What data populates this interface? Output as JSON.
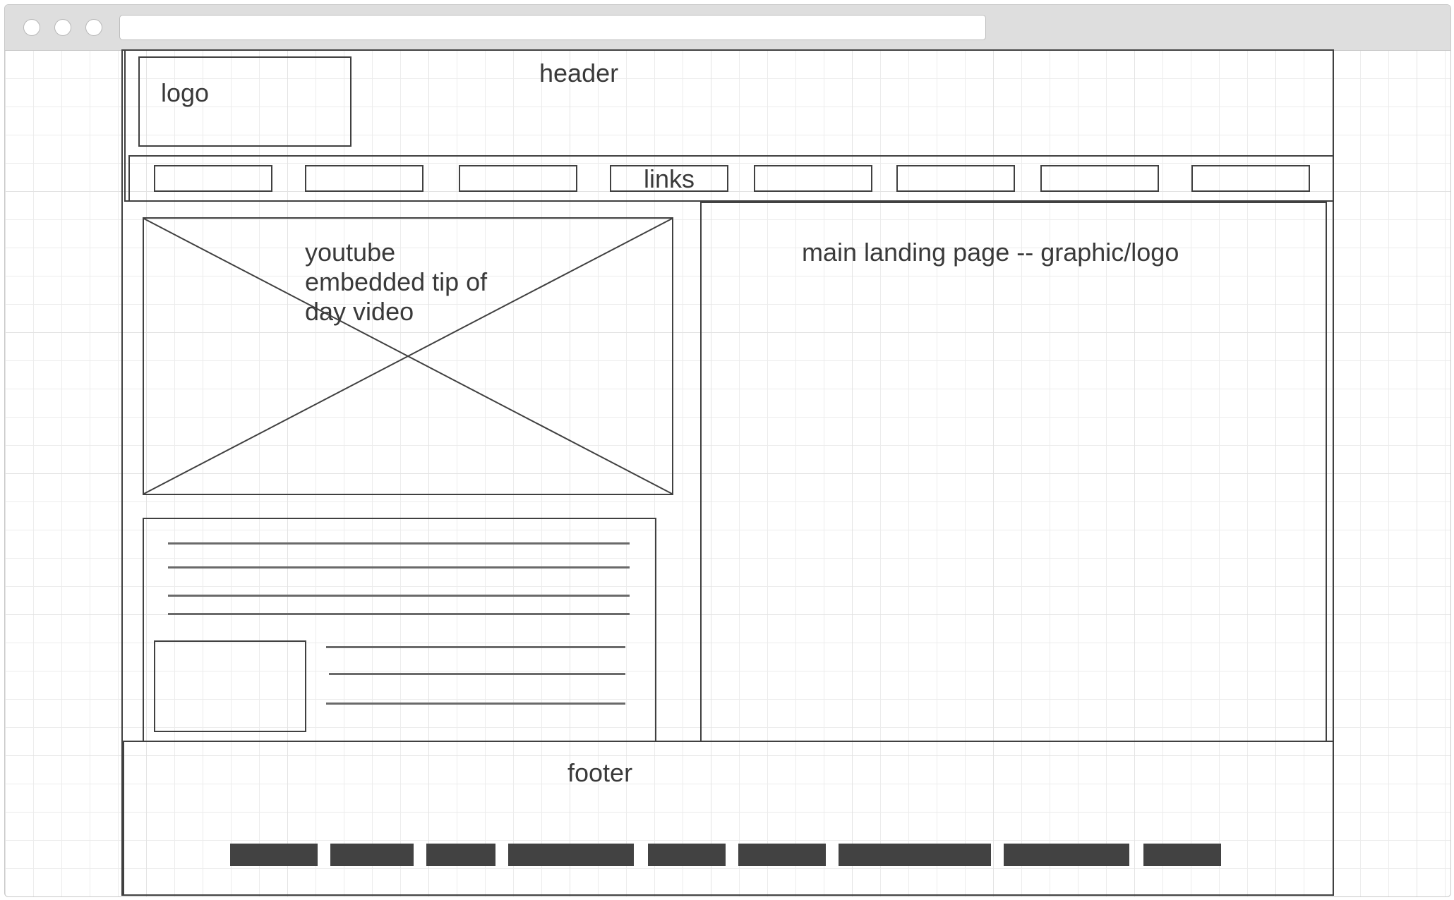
{
  "header": {
    "label": "header",
    "logo_label": "logo"
  },
  "nav": {
    "items": [
      {
        "label": ""
      },
      {
        "label": ""
      },
      {
        "label": ""
      },
      {
        "label": "links"
      },
      {
        "label": ""
      },
      {
        "label": ""
      },
      {
        "label": ""
      },
      {
        "label": ""
      }
    ]
  },
  "video": {
    "label_line1": "youtube",
    "label_line2": "embedded tip of",
    "label_line3": "day video"
  },
  "main": {
    "label": "main landing page -- graphic/logo"
  },
  "footer": {
    "label": "footer",
    "link_count": 9
  },
  "colors": {
    "stroke": "#404040",
    "footer_link": "#424242",
    "text": "#3a3a3a",
    "chrome": "#dedede"
  }
}
